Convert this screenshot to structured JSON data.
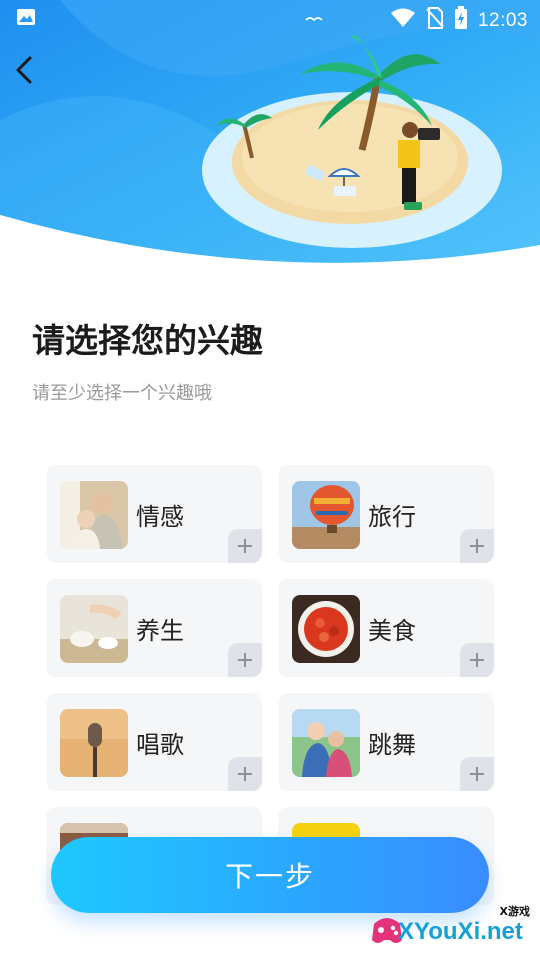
{
  "status_bar": {
    "time": "12:03",
    "icons": [
      "image-icon",
      "wifi-icon",
      "no-sim-icon",
      "battery-charging-icon"
    ]
  },
  "header": {
    "back_icon": "chevron-left-icon"
  },
  "page": {
    "title": "请选择您的兴趣",
    "subtitle": "请至少选择一个兴趣哦"
  },
  "interests": [
    {
      "label": "情感",
      "image": "elderly-couple-photo",
      "add_icon": "plus-icon"
    },
    {
      "label": "旅行",
      "image": "hot-air-balloon-photo",
      "add_icon": "plus-icon"
    },
    {
      "label": "养生",
      "image": "tea-pouring-photo",
      "add_icon": "plus-icon"
    },
    {
      "label": "美食",
      "image": "crayfish-dish-photo",
      "add_icon": "plus-icon"
    },
    {
      "label": "唱歌",
      "image": "microphone-photo",
      "add_icon": "plus-icon"
    },
    {
      "label": "跳舞",
      "image": "dancing-couple-photo",
      "add_icon": "plus-icon"
    },
    {
      "label": "",
      "image": "partial-photo-1",
      "add_icon": "plus-icon"
    },
    {
      "label": "",
      "image": "partial-photo-2",
      "add_icon": "plus-icon"
    }
  ],
  "actions": {
    "next_label": "下一步"
  },
  "watermark": {
    "small": "X游戏",
    "big": "XYouXi.net"
  },
  "colors": {
    "banner_blue": "#2ea6f5",
    "button_start": "#1ec9ff",
    "button_end": "#3a8cff",
    "card_bg": "#f5f6f8"
  }
}
